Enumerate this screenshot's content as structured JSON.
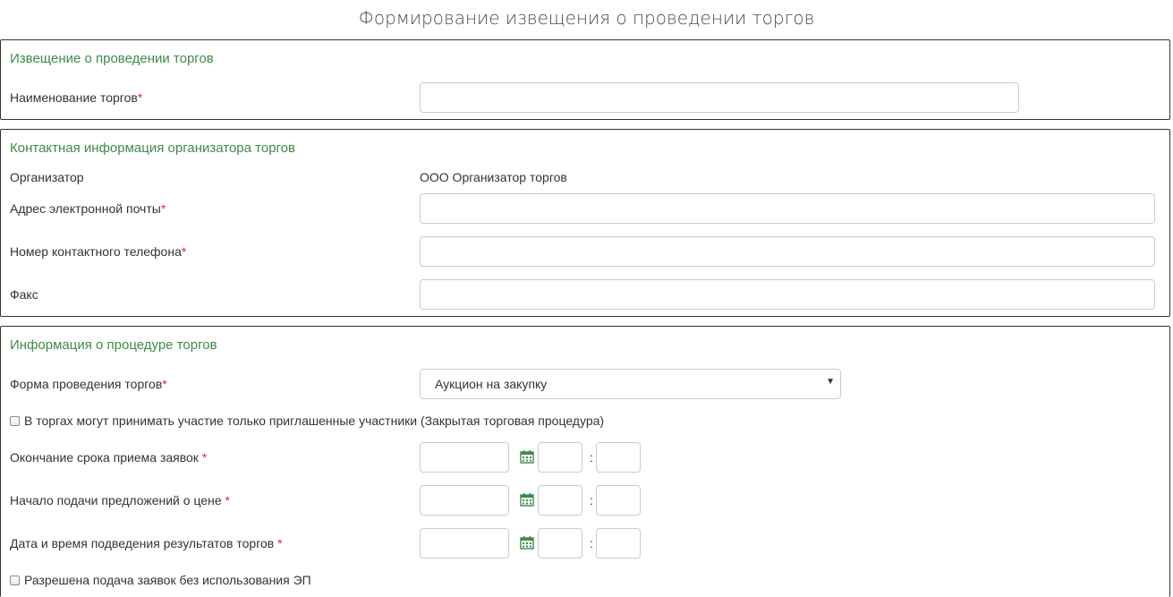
{
  "page": {
    "title": "Формирование извещения о проведении торгов"
  },
  "notice": {
    "heading": "Извещение о проведении торгов",
    "name_label": "Наименование торгов",
    "name_value": ""
  },
  "contact": {
    "heading": "Контактная информация организатора торгов",
    "organizer_label": "Организатор",
    "organizer_value": "ООО Организатор торгов",
    "email_label": "Адрес электронной почты",
    "email_value": "",
    "phone_label": "Номер контактного телефона",
    "phone_value": "",
    "fax_label": "Факс",
    "fax_value": ""
  },
  "procedure": {
    "heading": "Информация о процедуре торгов",
    "form_label": "Форма проведения торгов",
    "form_value": "Аукцион на закупку",
    "closed_label": "В торгах могут принимать участие только приглашенные участники (Закрытая торговая процедура)",
    "closed_checked": false,
    "deadline_label": "Окончание срока приема заявок",
    "start_label": "Начало подачи предложений о цене",
    "results_label": "Дата и время подведения результатов торгов",
    "no_ep_label": "Разрешена подача заявок без использования ЭП",
    "no_ep_checked": false,
    "time_separator": ":"
  },
  "required_mark": "*",
  "colors": {
    "heading": "#3f8a4a",
    "required": "#d9312b",
    "border": "#cccccc",
    "calendar": "#3f8a4a"
  },
  "icons": {
    "calendar": "calendar-icon",
    "select_arrow": "caret-down-icon"
  }
}
